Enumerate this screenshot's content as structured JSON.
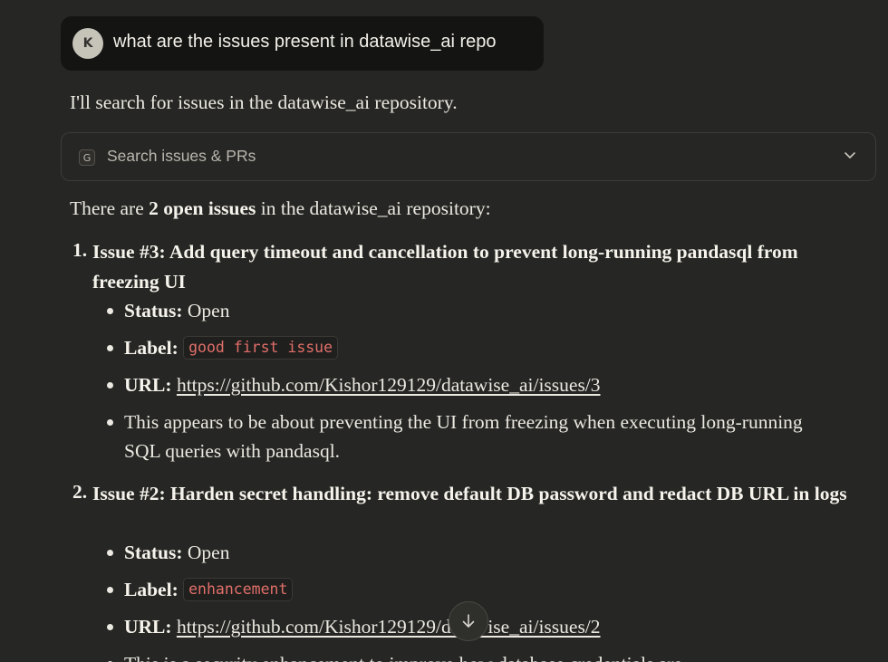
{
  "user_message": {
    "avatar_initial": "K",
    "text": "what are the issues present in datawise_ai repo"
  },
  "assistant": {
    "intro": "I'll search for issues in the datawise_ai repository.",
    "tool_call": {
      "icon_letter": "G",
      "icon": "github-tool-icon",
      "label": "Search issues & PRs",
      "chevron_icon": "chevron-down-icon"
    },
    "summary": {
      "prefix": "There are ",
      "bold": "2 open issues",
      "suffix": " in the datawise_ai repository:"
    },
    "issues": [
      {
        "number": "1.",
        "title": "Issue #3: Add query timeout and cancellation to prevent long-running pandasql from freezing UI",
        "status_label": "Status:",
        "status": "Open",
        "label_label": "Label:",
        "label": "good first issue",
        "url_label": "URL:",
        "url": "https://github.com/Kishor129129/datawise_ai/issues/3",
        "note": "This appears to be about preventing the UI from freezing when executing long-running SQL queries with pandasql."
      },
      {
        "number": "2.",
        "title": "Issue #2: Harden secret handling: remove default DB password and redact DB URL in logs",
        "status_label": "Status:",
        "status": "Open",
        "label_label": "Label:",
        "label": "enhancement",
        "url_label": "URL:",
        "url": "https://github.com/Kishor129129/datawise_ai/issues/2",
        "note": "This is a security enhancement to improve how database credentials are"
      }
    ]
  },
  "scroll_button": {
    "icon": "arrow-down-icon"
  },
  "colors": {
    "background": "#262624",
    "user_bubble": "#141413",
    "label_text": "#e16f6a"
  }
}
